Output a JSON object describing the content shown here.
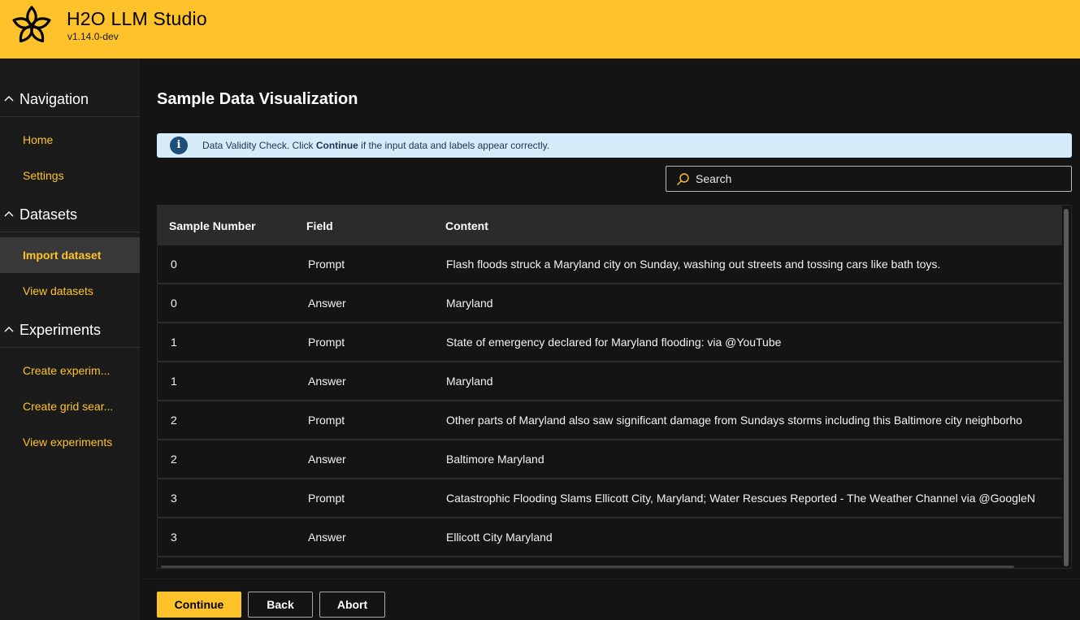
{
  "header": {
    "title": "H2O LLM Studio",
    "version": "v1.14.0-dev",
    "logo_icon": "h2o-star-logo",
    "color": "#fec32a"
  },
  "sidebar": {
    "groups": [
      {
        "label": "Navigation",
        "items": [
          {
            "label": "Home"
          },
          {
            "label": "Settings"
          }
        ]
      },
      {
        "label": "Datasets",
        "items": [
          {
            "label": "Import dataset",
            "active": true
          },
          {
            "label": "View datasets"
          }
        ]
      },
      {
        "label": "Experiments",
        "items": [
          {
            "label": "Create experim..."
          },
          {
            "label": "Create grid sear..."
          },
          {
            "label": "View experiments"
          }
        ]
      }
    ]
  },
  "main": {
    "title": "Sample Data Visualization",
    "info": {
      "icon": "info-icon",
      "prefix": "Data Validity Check. Click ",
      "bold": "Continue",
      "suffix": " if the input data and labels appear correctly."
    },
    "search": {
      "placeholder": "Search"
    },
    "table": {
      "columns": [
        "Sample Number",
        "Field",
        "Content"
      ],
      "rows": [
        [
          "0",
          "Prompt",
          "Flash floods struck a Maryland city on Sunday, washing out streets and tossing cars like bath toys."
        ],
        [
          "0",
          "Answer",
          "Maryland"
        ],
        [
          "1",
          "Prompt",
          "State of emergency declared for Maryland flooding: via @YouTube"
        ],
        [
          "1",
          "Answer",
          "Maryland"
        ],
        [
          "2",
          "Prompt",
          "Other parts of Maryland also saw significant damage from Sundays storms including this Baltimore city neighborho"
        ],
        [
          "2",
          "Answer",
          "Baltimore Maryland"
        ],
        [
          "3",
          "Prompt",
          "Catastrophic Flooding Slams Ellicott City, Maryland; Water Rescues Reported - The Weather Channel via @GoogleN"
        ],
        [
          "3",
          "Answer",
          "Ellicott City Maryland"
        ]
      ]
    }
  },
  "footer": {
    "continue_label": "Continue",
    "back_label": "Back",
    "abort_label": "Abort"
  }
}
